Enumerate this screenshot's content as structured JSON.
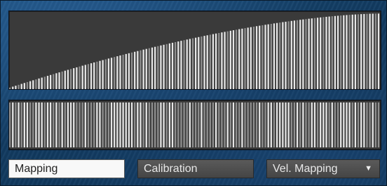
{
  "buttons": {
    "mapping": "Mapping",
    "calibration": "Calibration",
    "vel_mapping": "Vel. Mapping"
  },
  "icons": {
    "dropdown": "chevron-down-icon"
  },
  "colors": {
    "background": "#123b61",
    "graph_background": "#3a3a3a",
    "bar_light": "#e6e6e6",
    "bar_mid": "#8f8f8f",
    "active_button": "#f8f8f8",
    "button": "#505050"
  },
  "curve": {
    "bar_count": 128,
    "min_level": 0.02,
    "max_level": 0.97,
    "shape": "concave rising curve (logarithmic-like)"
  },
  "spread": {
    "bar_count": 128
  }
}
